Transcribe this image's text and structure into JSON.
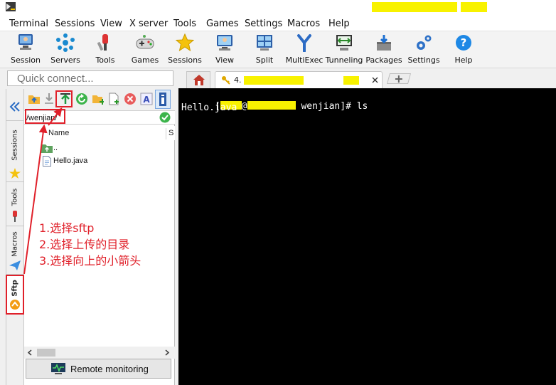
{
  "menu": [
    "Terminal",
    "Sessions",
    "View",
    "X server",
    "Tools",
    "Games",
    "Settings",
    "Macros",
    "Help"
  ],
  "toolbar": [
    "Session",
    "Servers",
    "Tools",
    "Games",
    "Sessions",
    "View",
    "Split",
    "MultiExec",
    "Tunneling",
    "Packages",
    "Settings",
    "Help"
  ],
  "quick_connect": {
    "placeholder": "Quick connect..."
  },
  "side_tabs": {
    "sessions": "Sessions",
    "tools": "Tools",
    "macros": "Macros",
    "sftp": "Sftp"
  },
  "sftp": {
    "path": "/wenjian/",
    "column_name": "Name",
    "column_size": "S",
    "files": [
      {
        "name": "..",
        "type": "parent-folder"
      },
      {
        "name": "Hello.java",
        "type": "file"
      }
    ],
    "remote_monitoring": "Remote monitoring"
  },
  "tabs": {
    "session_prefix": "4."
  },
  "terminal": {
    "prompt_start": "[",
    "prompt_at": "@",
    "prompt_end": " wenjian]# ls",
    "output": "Hello.java"
  },
  "annotation": {
    "lines": [
      "1.选择sftp",
      "2.选择上传的目录",
      "3.选择向上的小箭头"
    ]
  },
  "colors": {
    "annotation_red": "#e0202a",
    "redaction_yellow": "#f8f200",
    "terminal_bg": "#000000"
  }
}
